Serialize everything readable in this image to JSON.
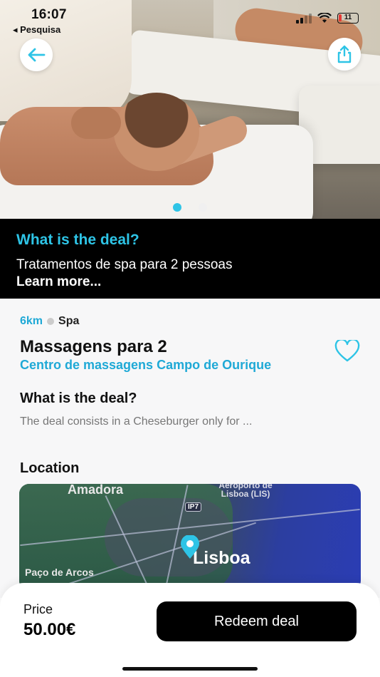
{
  "status_bar": {
    "time": "16:07",
    "back_label": "◂ Pesquisa",
    "battery": "11"
  },
  "hero": {
    "back_icon": "arrow-left-icon",
    "share_icon": "share-icon",
    "carousel_active_index": 0,
    "carousel_count": 2,
    "accent_color": "#2ec4e6"
  },
  "banner": {
    "title": "What is the deal?",
    "subtitle": "Tratamentos de spa para 2 pessoas",
    "learn_more": "Learn more..."
  },
  "deal": {
    "distance": "6km",
    "category": "Spa",
    "title": "Massagens para 2",
    "vendor": "Centro de massagens Campo de Ourique",
    "section_title": "What is the deal?",
    "description": "The deal consists in a Cheseburger only for ...",
    "favorite_icon": "heart-outline-icon"
  },
  "location": {
    "title": "Location",
    "map_labels": {
      "amadora": "Amadora",
      "airport": "Aeroporto de Lisboa (LIS)",
      "ip7": "IP7",
      "lisboa": "Lisboa",
      "paco": "Paço de Arcos"
    }
  },
  "footer": {
    "price_label": "Price",
    "price_value": "50.00€",
    "redeem_label": "Redeem deal"
  },
  "colors": {
    "accent": "#1fa9d6",
    "dark": "#000000"
  }
}
